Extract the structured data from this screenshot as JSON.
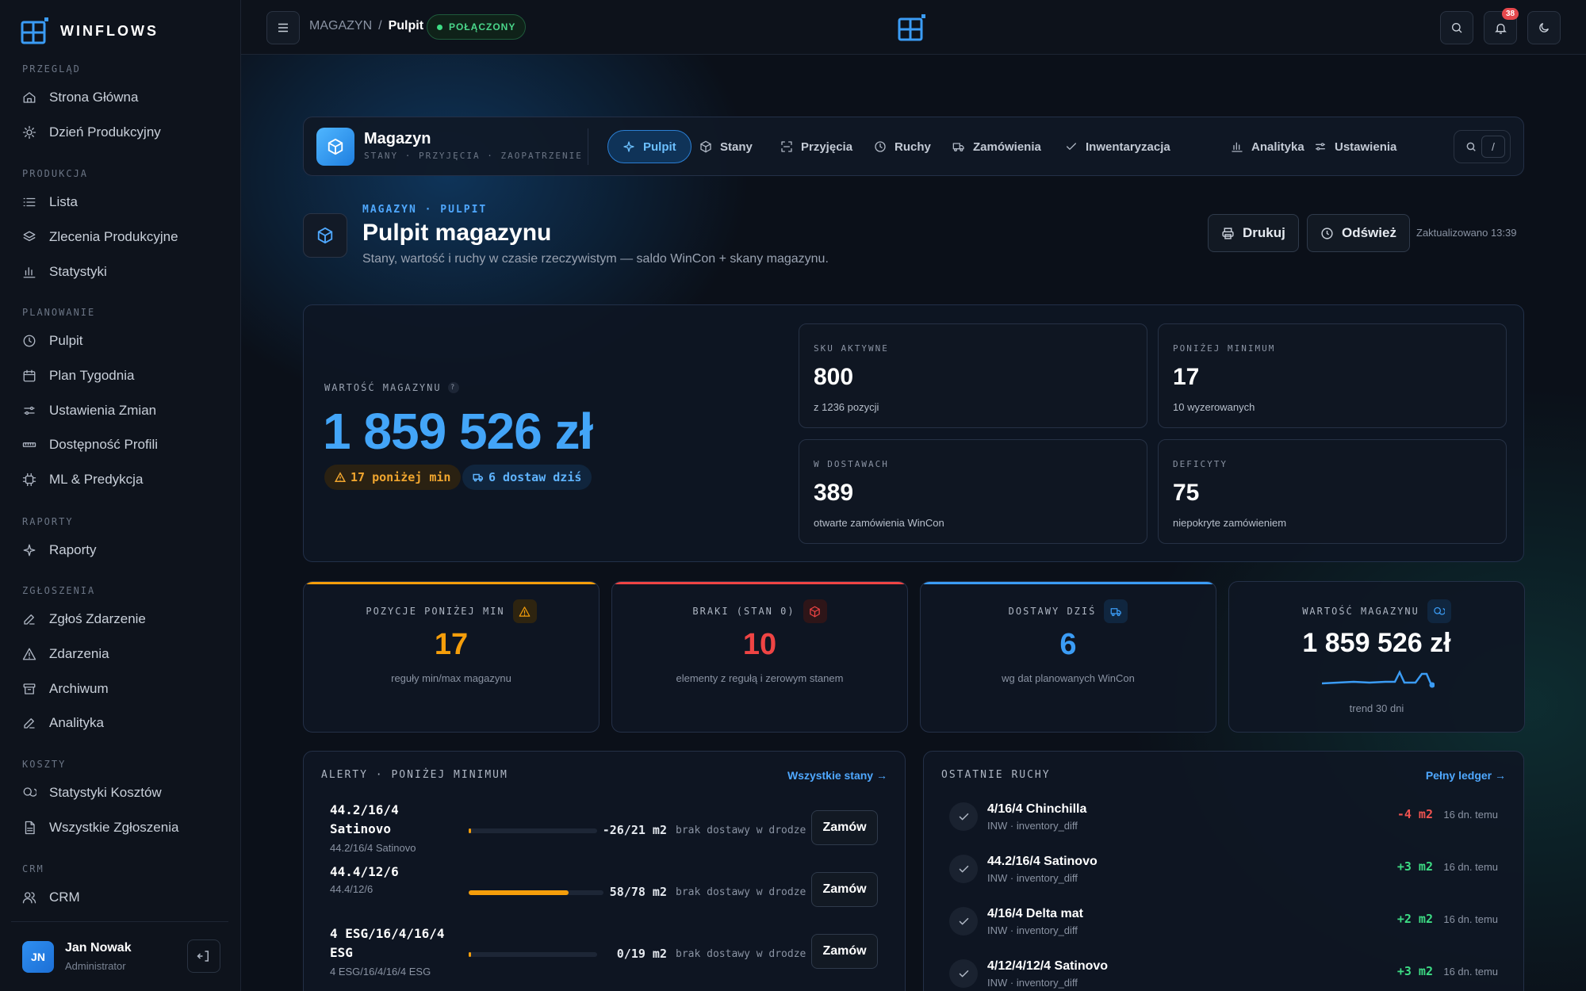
{
  "app": {
    "brand": "WINFLOWS"
  },
  "sidebar": {
    "sections": [
      {
        "title": "PRZEGLĄD",
        "items": [
          {
            "label": "Strona Główna",
            "icon": "home-icon"
          },
          {
            "label": "Dzień Produkcyjny",
            "icon": "sun-icon"
          }
        ]
      },
      {
        "title": "PRODUKCJA",
        "items": [
          {
            "label": "Lista",
            "icon": "list-icon"
          },
          {
            "label": "Zlecenia Produkcyjne",
            "icon": "layers-icon"
          },
          {
            "label": "Statystyki",
            "icon": "bar-chart-icon"
          }
        ]
      },
      {
        "title": "PLANOWANIE",
        "items": [
          {
            "label": "Pulpit",
            "icon": "clock-icon"
          },
          {
            "label": "Plan Tygodnia",
            "icon": "calendar-icon"
          },
          {
            "label": "Ustawienia Zmian",
            "icon": "sliders-icon"
          },
          {
            "label": "Dostępność Profili",
            "icon": "ruler-icon"
          },
          {
            "label": "ML & Predykcja",
            "icon": "chip-icon"
          }
        ]
      },
      {
        "title": "RAPORTY",
        "items": [
          {
            "label": "Raporty",
            "icon": "sparkle-icon"
          }
        ]
      },
      {
        "title": "ZGŁOSZENIA",
        "items": [
          {
            "label": "Zgłoś Zdarzenie",
            "icon": "pencil-icon"
          },
          {
            "label": "Zdarzenia",
            "icon": "warning-icon"
          },
          {
            "label": "Archiwum",
            "icon": "archive-icon"
          },
          {
            "label": "Analityka",
            "icon": "pencil-icon"
          }
        ]
      },
      {
        "title": "KOSZTY",
        "items": [
          {
            "label": "Statystyki Kosztów",
            "icon": "coins-icon"
          },
          {
            "label": "Wszystkie Zgłoszenia",
            "icon": "document-icon"
          }
        ]
      },
      {
        "title": "CRM",
        "items": [
          {
            "label": "CRM",
            "icon": "users-icon"
          }
        ]
      }
    ],
    "user": {
      "initials": "JN",
      "name": "Jan Nowak",
      "role": "Administrator"
    }
  },
  "topbar": {
    "breadcrumb_root": "MAGAZYN",
    "breadcrumb_sep": "/",
    "breadcrumb_current": "Pulpit",
    "status": "POŁĄCZONY",
    "notifications": "38"
  },
  "module": {
    "title": "Magazyn",
    "subtitle": "STANY · PRZYJĘCIA · ZAOPATRZENIE",
    "tabs": [
      {
        "label": "Pulpit",
        "icon": "sparkle-icon",
        "active": true
      },
      {
        "label": "Stany",
        "icon": "box-icon"
      },
      {
        "label": "Przyjęcia",
        "icon": "scan-icon"
      },
      {
        "label": "Ruchy",
        "icon": "clock-icon"
      },
      {
        "label": "Zamówienia",
        "icon": "truck-icon"
      },
      {
        "label": "Inwentaryzacja",
        "icon": "check-icon"
      },
      {
        "label": "Analityka",
        "icon": "bar-chart-icon"
      },
      {
        "label": "Ustawienia",
        "icon": "sliders-icon"
      }
    ],
    "search_key": "/"
  },
  "header": {
    "eyebrow": "MAGAZYN · PULPIT",
    "title": "Pulpit magazynu",
    "subtitle": "Stany, wartość i ruchy w czasie rzeczywistym — saldo WinCon + skany magazynu.",
    "print_label": "Drukuj",
    "refresh_label": "Odśwież",
    "updated": "Zaktualizowano 13:39"
  },
  "hero": {
    "label": "WARTOŚĆ MAGAZYNU",
    "help": "?",
    "value": "1 859 526 zł",
    "pill_warn": "17 poniżej min",
    "pill_info": "6 dostaw dziś",
    "kpis": [
      {
        "label": "SKU AKTYWNE",
        "value": "800",
        "sub": "z 1236 pozycji"
      },
      {
        "label": "PONIŻEJ MINIMUM",
        "value": "17",
        "sub": "10 wyzerowanych"
      },
      {
        "label": "W DOSTAWACH",
        "value": "389",
        "sub": "otwarte zamówienia WinCon"
      },
      {
        "label": "DEFICYTY",
        "value": "75",
        "sub": "niepokryte zamówieniem"
      }
    ]
  },
  "stats": [
    {
      "label": "POZYCJE PONIŻEJ MIN",
      "value": "17",
      "sub": "reguły min/max magazynu",
      "color": "#f59e0b",
      "icon": "warning-icon"
    },
    {
      "label": "BRAKI (STAN 0)",
      "value": "10",
      "sub": "elementy z regułą i zerowym stanem",
      "color": "#ef4444",
      "icon": "box-icon"
    },
    {
      "label": "DOSTAWY DZIŚ",
      "value": "6",
      "sub": "wg dat planowanych WinCon",
      "color": "#3b9cf5",
      "icon": "truck-icon"
    },
    {
      "label": "WARTOŚĆ MAGAZYNU",
      "value": "1 859 526 zł",
      "sub": "trend 30 dni",
      "color": "#ffffff",
      "icon": "coins-icon"
    }
  ],
  "alerts": {
    "title": "ALERTY · PONIŻEJ MINIMUM",
    "link": "Wszystkie stany →",
    "order_label": "Zamów",
    "rows": [
      {
        "name": "44.2/16/4 Satinovo",
        "code": "44.2/16/4 Satinovo",
        "qty": "-26/21 m2",
        "fill": 0.02,
        "note": "brak dostawy w drodze"
      },
      {
        "name": "44.4/12/6",
        "code": "44.4/12/6",
        "qty": "58/78 m2",
        "fill": 0.74,
        "note": "brak dostawy w drodze"
      },
      {
        "name": "4 ESG/16/4/16/4 ESG",
        "code": "4 ESG/16/4/16/4 ESG",
        "qty": "0/19 m2",
        "fill": 0.02,
        "note": "brak dostawy w drodze"
      }
    ]
  },
  "movements": {
    "title": "OSTATNIE RUCHY",
    "link": "Pełny ledger →",
    "rows": [
      {
        "name": "4/16/4 Chinchilla",
        "sub": "INW · inventory_diff",
        "delta": "-4 m2",
        "dir": "neg",
        "time": "16 dn. temu"
      },
      {
        "name": "44.2/16/4 Satinovo",
        "sub": "INW · inventory_diff",
        "delta": "+3 m2",
        "dir": "pos",
        "time": "16 dn. temu"
      },
      {
        "name": "4/16/4 Delta mat",
        "sub": "INW · inventory_diff",
        "delta": "+2 m2",
        "dir": "pos",
        "time": "16 dn. temu"
      },
      {
        "name": "4/12/4/12/4 Satinovo",
        "sub": "INW · inventory_diff",
        "delta": "+3 m2",
        "dir": "pos",
        "time": "16 dn. temu"
      }
    ]
  }
}
